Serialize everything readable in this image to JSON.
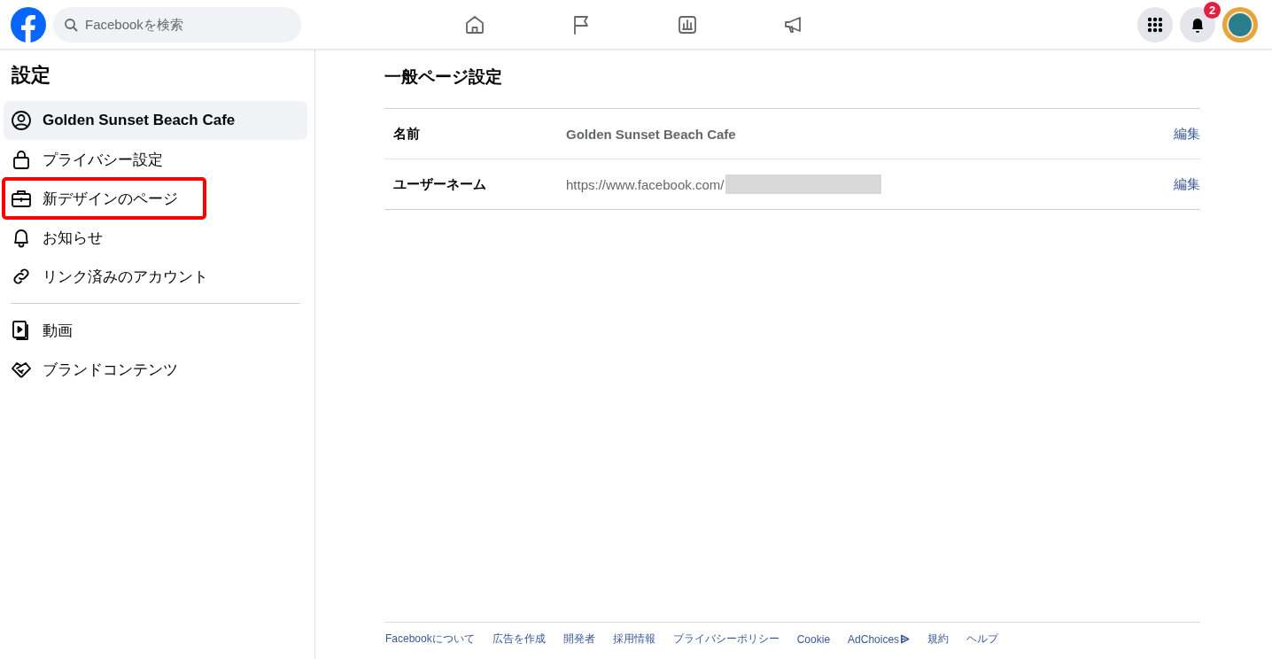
{
  "header": {
    "search": {
      "placeholder": "Facebookを検索"
    },
    "nav": [
      {
        "kind": "home",
        "selected": false
      },
      {
        "kind": "flag",
        "selected": false
      },
      {
        "kind": "chart",
        "selected": false
      },
      {
        "kind": "megaphone",
        "selected": false
      }
    ],
    "notifications": {
      "badge": "2"
    }
  },
  "sidebar": {
    "title": "設定",
    "items": [
      {
        "kind": "person",
        "label": "Golden Sunset Beach Cafe",
        "selected": true,
        "highlighted": false
      },
      {
        "kind": "lock",
        "label": "プライバシー設定",
        "selected": false,
        "highlighted": false
      },
      {
        "kind": "briefcase",
        "label": "新デザインのページ",
        "selected": false,
        "highlighted": true
      },
      {
        "kind": "bell",
        "label": "お知らせ",
        "selected": false,
        "highlighted": false
      },
      {
        "kind": "link",
        "label": "リンク済みのアカウント",
        "selected": false,
        "highlighted": false
      },
      {
        "kind": "divider"
      },
      {
        "kind": "video",
        "label": "動画",
        "selected": false,
        "highlighted": false
      },
      {
        "kind": "handshake",
        "label": "ブランドコンテンツ",
        "selected": false,
        "highlighted": false
      }
    ]
  },
  "main": {
    "title": "一般ページ設定",
    "rows": [
      {
        "label": "名前",
        "value": "Golden Sunset Beach Cafe",
        "redacted": false,
        "action": "編集"
      },
      {
        "label": "ユーザーネーム",
        "value": "https://www.facebook.com/",
        "redacted": true,
        "action": "編集"
      }
    ]
  },
  "footer": {
    "links": [
      {
        "label": "Facebookについて",
        "icon": false
      },
      {
        "label": "広告を作成",
        "icon": false
      },
      {
        "label": "開発者",
        "icon": false
      },
      {
        "label": "採用情報",
        "icon": false
      },
      {
        "label": "プライバシーポリシー",
        "icon": false
      },
      {
        "label": "Cookie",
        "icon": false
      },
      {
        "label": "AdChoices",
        "icon": true
      },
      {
        "label": "規約",
        "icon": false
      },
      {
        "label": "ヘルプ",
        "icon": false
      }
    ]
  }
}
